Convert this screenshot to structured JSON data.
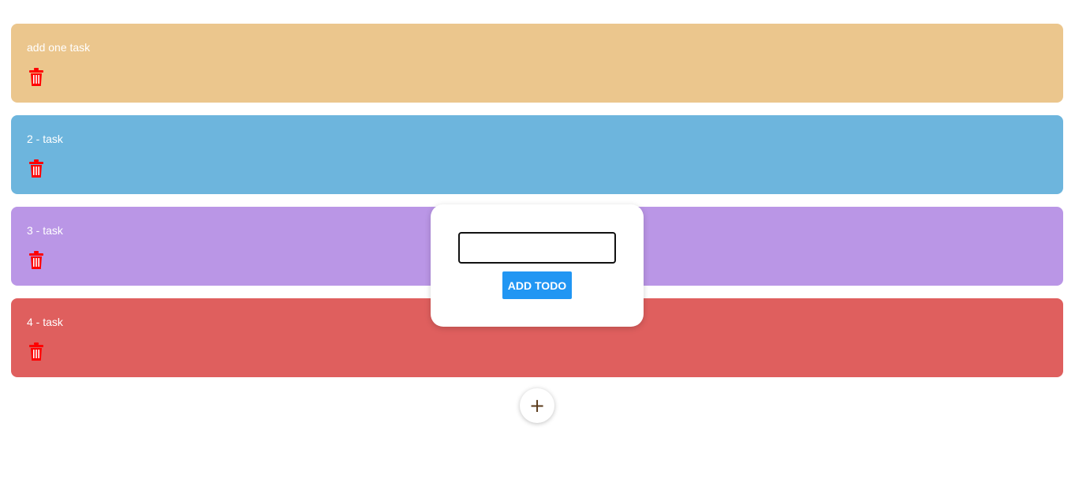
{
  "todos": [
    {
      "text": "add one task",
      "color": "#EBC68D",
      "delete_icon": "trash-icon"
    },
    {
      "text": "2 - task",
      "color": "#6DB5DD",
      "delete_icon": "trash-icon"
    },
    {
      "text": "3 - task",
      "color": "#BA96E6",
      "delete_icon": "trash-icon"
    },
    {
      "text": "4 - task",
      "color": "#DF5F5E",
      "delete_icon": "trash-icon"
    }
  ],
  "modal": {
    "input_value": "",
    "add_button_label": "ADD TODO",
    "add_button_color": "#2196F3"
  },
  "fab": {
    "icon": "plus-icon",
    "label": "+"
  },
  "colors": {
    "trash": "#FF0000",
    "text": "#FFFFFF"
  }
}
